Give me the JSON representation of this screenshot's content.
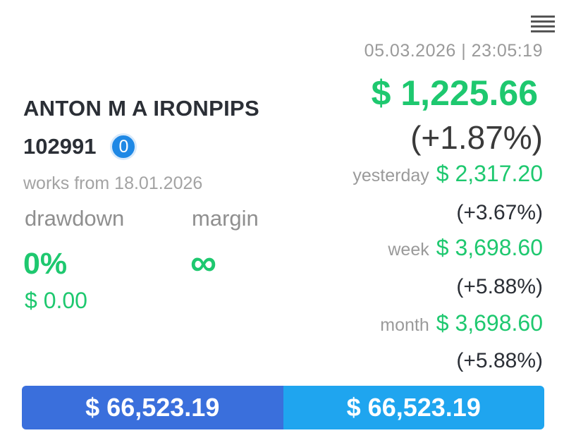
{
  "header": {
    "menu_icon": "hamburger-menu-icon",
    "datetime": "05.03.2026 | 23:05:19"
  },
  "account": {
    "name": "ANTON M A IRONPIPS",
    "id": "102991",
    "badge": "0",
    "works_from": "works from 18.01.2026"
  },
  "stats": {
    "drawdown_label": "drawdown",
    "drawdown_value": "0%",
    "drawdown_amount": "$ 0.00",
    "margin_label": "margin",
    "margin_value": "∞"
  },
  "performance": {
    "balance": "$ 1,225.66",
    "balance_pct": "(+1.87%)",
    "periods": [
      {
        "label": "yesterday",
        "value": "$ 2,317.20",
        "pct": "(+3.67%)"
      },
      {
        "label": "week",
        "value": "$ 3,698.60",
        "pct": "(+5.88%)"
      },
      {
        "label": "month",
        "value": "$ 3,698.60",
        "pct": "(+5.88%)"
      }
    ]
  },
  "footer": {
    "left_value": "$ 66,523.19",
    "right_value": "$ 66,523.19"
  },
  "colors": {
    "green": "#1ec86f",
    "blue_left": "#3a6fdc",
    "blue_right": "#1fa5ef",
    "badge": "#1e88e5"
  }
}
